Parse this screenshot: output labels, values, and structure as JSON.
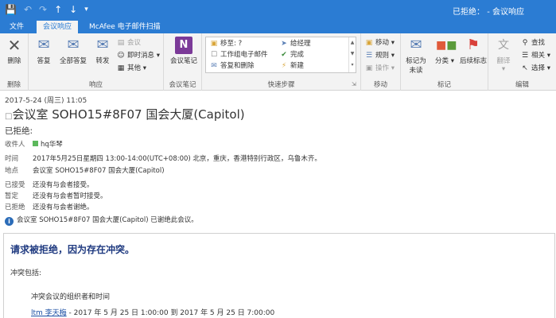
{
  "titlebar": {
    "title": "已拒绝： - 会议响应",
    "qat": {
      "save_icon": "save-icon",
      "undo_icon": "undo-icon",
      "redo_icon": "redo-icon",
      "up_icon": "up-icon",
      "down_icon": "down-icon"
    }
  },
  "tabs": [
    {
      "label": "文件"
    },
    {
      "label": "会议响应"
    },
    {
      "label": "McAfee 电子邮件扫描"
    }
  ],
  "ribbon": {
    "delete_group": {
      "label": "删除",
      "delete": "删除"
    },
    "respond_group": {
      "label": "响应",
      "reply": "答复",
      "reply_all": "全部答复",
      "forward": "转发",
      "meeting": "会议",
      "im": "即时消息",
      "more": "其他"
    },
    "notes_group": {
      "label": "会议笔记",
      "notes": "会议笔记"
    },
    "quicksteps_group": {
      "label": "快速步骤",
      "items": [
        "移至: ?",
        "工作组电子邮件",
        "答复和删除",
        "给经理",
        "完成",
        "新建"
      ]
    },
    "move_group": {
      "label": "移动",
      "move": "移动",
      "rules": "规则",
      "actions": "操作"
    },
    "tags_group": {
      "label": "标记",
      "mark_unread": "标记为",
      "mark_unread2": "未读",
      "categorize": "分类",
      "followup": "后续标志"
    },
    "edit_group": {
      "label": "编辑",
      "translate": "翻译",
      "find": "查找",
      "related": "相关",
      "select": "选择"
    }
  },
  "header": {
    "date": "2017-5-24 (周三) 11:05",
    "subject": "会议室 SOHO15#8F07 国会大厦(Capitol)",
    "declined_label": "已拒绝:",
    "recipient_label": "收件人",
    "recipient": "hq华琴",
    "time_label": "时间",
    "time_value": "2017年5月25日星期四 13:00-14:00(UTC+08:00) 北京，重庆，香港特别行政区，乌鲁木齐。",
    "location_label": "地点",
    "location_value": "会议室 SOHO15#8F07 国会大厦(Capitol)",
    "accepted_label": "已接受",
    "accepted_value": "还没有与会者接受。",
    "tentative_label": "暂定",
    "tentative_value": "还没有与会者暂时接受。",
    "declined2_label": "已拒绝",
    "declined2_value": "还没有与会者谢绝。",
    "info": "会议室 SOHO15#8F07 国会大厦(Capitol) 已谢绝此会议。"
  },
  "body": {
    "title": "请求被拒绝，因为存在冲突。",
    "conflicts_label": "冲突包括:",
    "organizer_label": "冲突会议的组织者和时间",
    "organizer_link": "ltm 李天梅",
    "organizer_time": " - 2017 年 5 月 25 日 1:00:00 到 2017 年 5 月 25 日 7:00:00"
  },
  "colors": {
    "accent": "#2b7cd3",
    "ribbon_bg": "#f3f3f3",
    "title_blue": "#1f3a80"
  }
}
